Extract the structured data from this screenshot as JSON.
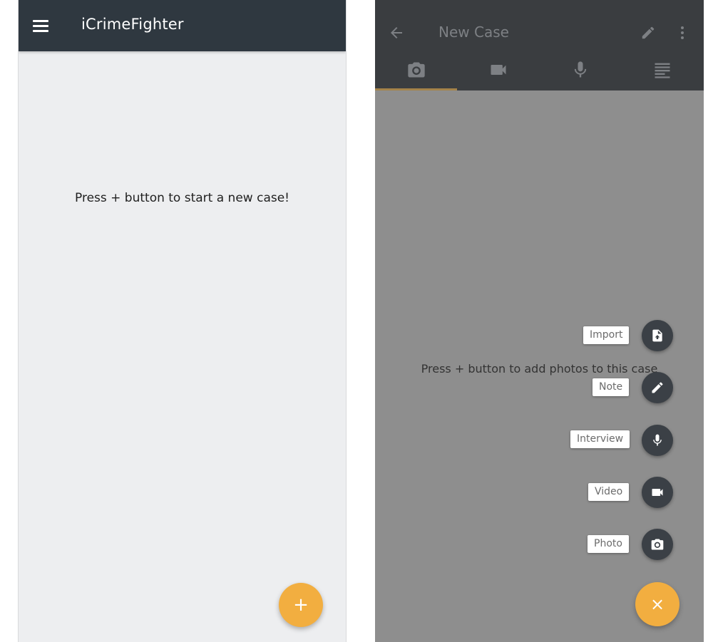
{
  "left_screen": {
    "app_title": "iCrimeFighter",
    "empty_message": "Press + button to start a new case!",
    "fab_label": "+"
  },
  "right_screen": {
    "case_title": "New Case",
    "tabs": [
      {
        "icon": "camera-icon",
        "selected": true
      },
      {
        "icon": "video-camera-icon",
        "selected": false
      },
      {
        "icon": "microphone-icon",
        "selected": false
      },
      {
        "icon": "notes-icon",
        "selected": false
      }
    ],
    "empty_message": "Press + button to add photos to this case",
    "speed_dial": [
      {
        "label": "Import",
        "icon": "import-file-icon"
      },
      {
        "label": "Note",
        "icon": "pencil-icon"
      },
      {
        "label": "Interview",
        "icon": "microphone-icon"
      },
      {
        "label": "Video",
        "icon": "video-camera-icon"
      },
      {
        "label": "Photo",
        "icon": "camera-icon"
      }
    ],
    "fab_close_label": "×"
  },
  "colors": {
    "toolbar_dark": "#2f3840",
    "accent_fab": "#f2ae40",
    "overlay_gray": "#8e8e8e",
    "mini_fab": "#3b4046",
    "left_background": "#edeef0"
  }
}
